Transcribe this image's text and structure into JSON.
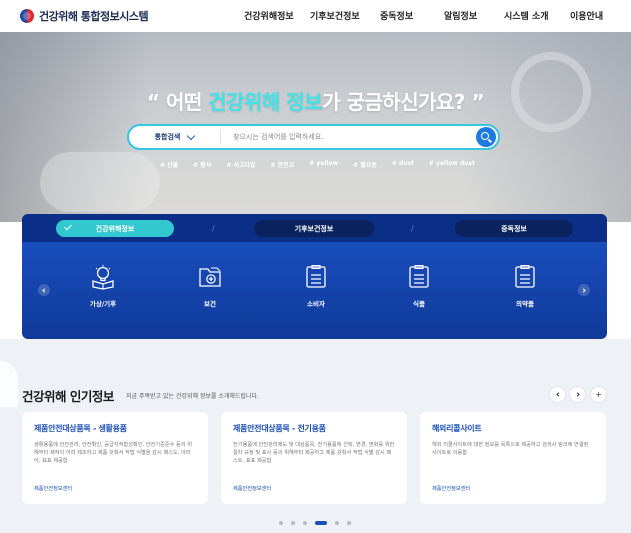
{
  "header": {
    "logo_text": "건강위해 통합정보시스템",
    "nav": [
      "건강위해정보",
      "기후보건정보",
      "중독정보",
      "알림정보",
      "시스템 소개",
      "이용안내"
    ]
  },
  "hero": {
    "title_prefix": "“ 어떤 ",
    "title_highlight": "건강위해 정보",
    "title_suffix": "가 궁금하신가요? ”",
    "search": {
      "scope": "통합검색",
      "placeholder": "찾으시는 검색어를 입력하세요."
    },
    "tags": [
      "# 산불",
      "# 황사",
      "# 사고다발",
      "# 안전교",
      "# yellow",
      "# 월요종",
      "# dust",
      "# yellow dust"
    ]
  },
  "categories": {
    "tabs": [
      "건강위해정보",
      "기후보건정보",
      "중독정보"
    ],
    "separator": "/",
    "items": [
      {
        "label": "가상/기후",
        "icon": "lightbulb-book-icon"
      },
      {
        "label": "보건",
        "icon": "medical-folder-icon"
      },
      {
        "label": "소비자",
        "icon": "document-list-icon"
      },
      {
        "label": "식품",
        "icon": "document-list-icon"
      },
      {
        "label": "의약품",
        "icon": "document-list-icon"
      }
    ]
  },
  "popular": {
    "title": "건강위해 인기정보",
    "subtitle": "지금 주목받고 있는 건강위해 정보를 소개해드립니다.",
    "plus": "+",
    "cards": [
      {
        "title": "제품안전대상품목 - 생활용품",
        "desc": "생활용품에 안전관리, 안전확인, 공급자적합성확인, 안전기준준수 등의 위해부터 제작이 어려 제조하고 제품 갖춰서 적법 식별을 감시 패스도, 야리어, 표표 제공합",
        "link": "제품안전정보센터"
      },
      {
        "title": "제품안전대상품목 - 전기용품",
        "desc": "전기용품에 안전관리제도 및 대상품목, 전기용품에 선택, 변경, 변화를 위한 절차 규정 및 표시 등의 위해부터 제공하고 제품 갖춰서 적법 식별 감시 패스트, 표표 제공합",
        "link": "제품안전정보센터"
      },
      {
        "title": "해외리콜사이트",
        "desc": "해외 리콜사이트에 대한 정보를 목록으로 제공하고 검색시 링크에 연결된 사이트로 이동함",
        "link": "제품안전정보센터"
      }
    ],
    "pagination": {
      "count": 6,
      "active_index": 3
    }
  }
}
